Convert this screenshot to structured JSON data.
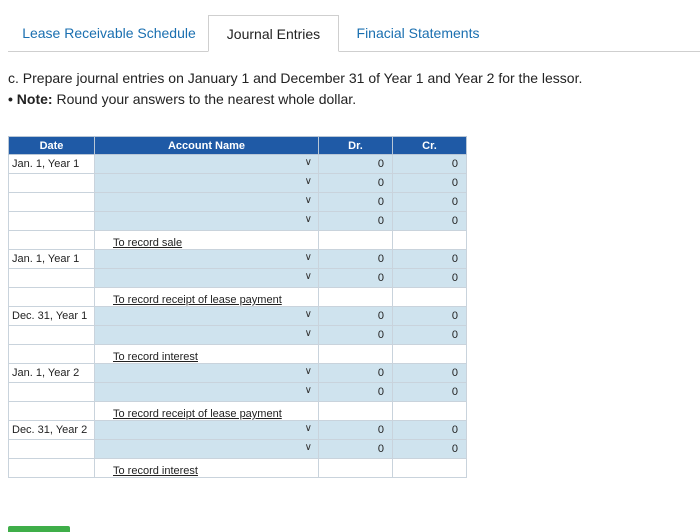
{
  "tabs": [
    {
      "label": "Lease Receivable Schedule",
      "active": false
    },
    {
      "label": "Journal Entries",
      "active": true
    },
    {
      "label": "Finacial Statements",
      "active": false
    }
  ],
  "instructions": {
    "line1": "c. Prepare journal entries on January 1 and December 31 of Year 1 and Year 2 for the lessor.",
    "note_bullet": "•",
    "note_label": "Note:",
    "note_text": " Round your answers to the nearest whole dollar."
  },
  "table": {
    "headers": {
      "date": "Date",
      "account": "Account Name",
      "dr": "Dr.",
      "cr": "Cr."
    },
    "entries": [
      {
        "date": "Jan. 1, Year 1",
        "rows": 4,
        "memo": "To record sale"
      },
      {
        "date": "Jan. 1, Year 1",
        "rows": 2,
        "memo": "To record receipt of lease payment"
      },
      {
        "date": "Dec. 31, Year 1",
        "rows": 2,
        "memo": "To record interest"
      },
      {
        "date": "Jan. 1, Year 2",
        "rows": 2,
        "memo": "To record receipt of lease payment"
      },
      {
        "date": "Dec. 31, Year 2",
        "rows": 2,
        "memo": "To record interest"
      }
    ],
    "default_value": "0"
  },
  "colors": {
    "header_bg": "#1f5aa6",
    "input_bg": "#cfe3ee",
    "tab_link": "#1a6fb0",
    "button_green": "#3fae49"
  }
}
